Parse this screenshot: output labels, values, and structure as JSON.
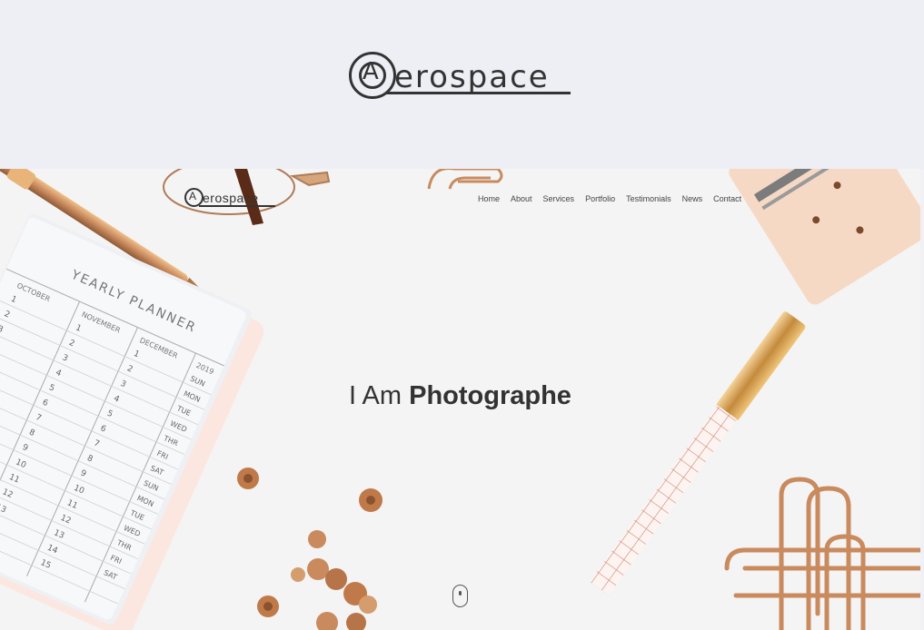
{
  "site": {
    "logo_letter": "A",
    "logo_word": "erospace"
  },
  "nav": {
    "items": [
      "Home",
      "About",
      "Services",
      "Portfolio",
      "Testimonials",
      "News",
      "Contact"
    ]
  },
  "hero": {
    "headline_prefix": "I Am",
    "headline_strong": "Photographe"
  },
  "planner": {
    "title": "YEARLY PLANNER",
    "months": [
      "OCTOBER",
      "NOVEMBER",
      "DECEMBER"
    ],
    "year": "2019",
    "numbers": [
      "1",
      "2",
      "3",
      "4",
      "5",
      "6",
      "7",
      "8",
      "9",
      "10",
      "11",
      "12",
      "13",
      "14",
      "15"
    ],
    "days": [
      "SUN",
      "MON",
      "TUE",
      "WED",
      "THR",
      "FRI",
      "SAT",
      "SUN",
      "MON",
      "TUE",
      "WED",
      "THR",
      "FRI",
      "SAT"
    ]
  },
  "colors": {
    "copper": "#c98a5e",
    "copper_dark": "#a86a40",
    "gold": "#d9a55a",
    "text": "#333333",
    "topbar_bg": "#eeeff5",
    "hero_bg": "#f4f4f4"
  }
}
